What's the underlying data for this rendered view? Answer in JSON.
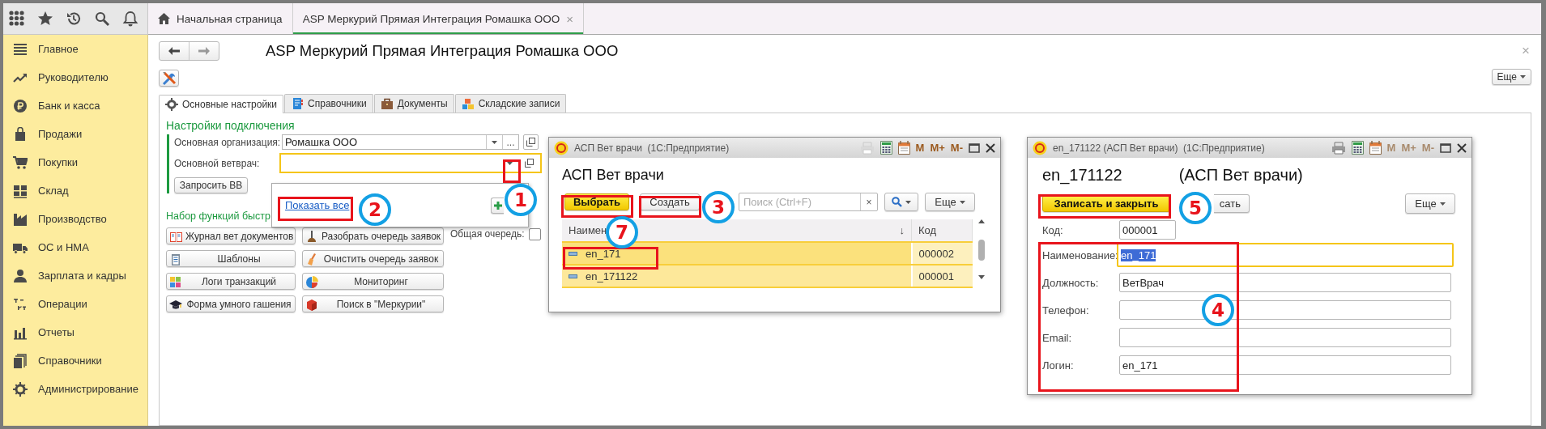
{
  "top_tabs": [
    {
      "label": "Начальная страница",
      "selected": false
    },
    {
      "label": "ASP Меркурий Прямая Интеграция Ромашка ООО",
      "selected": true,
      "close": "×"
    }
  ],
  "sidebar": {
    "items": [
      {
        "label": "Главное"
      },
      {
        "label": "Руководителю"
      },
      {
        "label": "Банк и касса"
      },
      {
        "label": "Продажи"
      },
      {
        "label": "Покупки"
      },
      {
        "label": "Склад"
      },
      {
        "label": "Производство"
      },
      {
        "label": "ОС и НМА"
      },
      {
        "label": "Зарплата и кадры"
      },
      {
        "label": "Операции"
      },
      {
        "label": "Отчеты"
      },
      {
        "label": "Справочники"
      },
      {
        "label": "Администрирование"
      }
    ]
  },
  "form": {
    "title": "ASP Меркурий Прямая Интеграция Ромашка ООО",
    "close": "×",
    "more_button": "Еще",
    "tabs": [
      {
        "label": "Основные настройки",
        "selected": true
      },
      {
        "label": "Справочники",
        "selected": false
      },
      {
        "label": "Документы",
        "selected": false
      },
      {
        "label": "Складские записи",
        "selected": false
      }
    ],
    "connection_group": {
      "title": "Настройки подключения",
      "organization": {
        "label": "Основная организация:",
        "value": "Ромашка ООО",
        "choose": "...",
        "focused": false
      },
      "vet": {
        "label": "Основной ветврач:",
        "focused": true
      },
      "request_button": "Запросить ВВ"
    },
    "dropdown": {
      "link": "Показать все"
    },
    "functions_group": {
      "title": "Набор функций быстр",
      "buttons": [
        "Журнал вет документов",
        "Разобрать очередь заявок",
        "Шаблоны",
        "Очистить очередь заявок",
        "Логи транзакций",
        "Мониторинг",
        "Форма умного гашения",
        "Поиск в \"Меркурии\""
      ],
      "common_queue": {
        "label": "Общая очередь:",
        "checked": false
      }
    }
  },
  "list_window": {
    "title": "АСП Вет врачи  (1С:Предприятие)",
    "memory_buttons": [
      {
        "label": "M",
        "disabled": false
      },
      {
        "label": "M+",
        "disabled": false
      },
      {
        "label": "M-",
        "disabled": false
      }
    ],
    "heading": "АСП Вет врачи",
    "select_button": "Выбрать",
    "create_button": "Создать",
    "search": {
      "placeholder": "Поиск (Ctrl+F)",
      "clear": "×"
    },
    "more_button": "Еще",
    "columns": [
      {
        "label": "Наимен",
        "sort": "↓"
      },
      {
        "label": "Код"
      }
    ],
    "rows": [
      {
        "name": "en_171",
        "code": "000002",
        "selected": true,
        "current": true
      },
      {
        "name": "en_171122",
        "code": "000001",
        "selected": true,
        "current": false
      }
    ]
  },
  "item_window": {
    "title": "en_171122 (АСП Вет врачи)  (1С:Предприятие)",
    "memory_buttons": [
      {
        "label": "M",
        "disabled": true
      },
      {
        "label": "M+",
        "disabled": true
      },
      {
        "label": "M-",
        "disabled": true
      }
    ],
    "heading": "en_171122",
    "heading_note": "(АСП Вет врачи)",
    "save_close_button": "Записать и закрыть",
    "save_button": "сать",
    "more_button": "Еще",
    "code": {
      "label": "Код:",
      "value": "000001"
    },
    "fields": [
      {
        "label": "Наименование:",
        "value": "en_171",
        "focused": true
      },
      {
        "label": "Должность:",
        "value": "ВетВрач",
        "focused": false
      },
      {
        "label": "Телефон:",
        "focused": false
      },
      {
        "label": "Email:",
        "focused": false
      },
      {
        "label": "Логин:",
        "value": "en_171",
        "focused": false
      }
    ]
  },
  "annotations": [
    {
      "label": "1"
    },
    {
      "label": "2"
    },
    {
      "label": "3"
    },
    {
      "label": "7"
    },
    {
      "label": "5"
    },
    {
      "label": "4"
    }
  ]
}
